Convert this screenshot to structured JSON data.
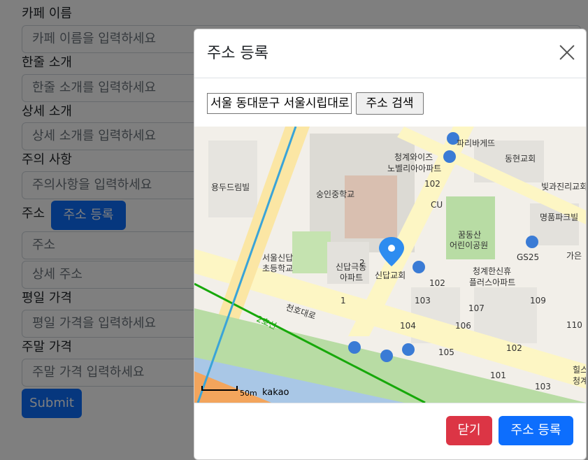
{
  "form": {
    "cafe_name_label": "카페 이름",
    "cafe_name_placeholder": "카페 이름을 입력하세요",
    "intro_label": "한줄 소개",
    "intro_placeholder": "한줄 소개를 입력하세요",
    "detail_label": "상세 소개",
    "detail_placeholder": "상세 소개를 입력하세요",
    "notice_label": "주의 사항",
    "notice_placeholder": "주의사항을 입력하세요",
    "address_label": "주소",
    "address_register_button": "주소 등록",
    "address_placeholder": "주소",
    "address_detail_placeholder": "상세 주소",
    "weekday_price_label": "평일 가격",
    "weekday_price_placeholder": "평일 가격을 입력하세요",
    "weekend_price_label": "주말 가격",
    "weekend_price_placeholder": "주말 가격 입력하세요",
    "submit_button": "Submit"
  },
  "modal": {
    "title": "주소 등록",
    "search_value": "서울 동대문구 서울시립대로",
    "search_button": "주소 검색",
    "close_button": "닫기",
    "register_button": "주소 등록"
  },
  "map": {
    "labels": {
      "pari": "파리바게뜨",
      "church1": "동현교회",
      "apt1_line1": "청계와이즈",
      "apt1_line2": "노벨리아아파트",
      "num102a": "102",
      "cu": "CU",
      "bitgwa": "빛과진리교회",
      "villa": "용두드림빌",
      "school1": "숭인중학교",
      "myeongpum": "명품파크빌",
      "park_line1": "꿈동산",
      "park_line2": "어린이공원",
      "gs25": "GS25",
      "gaeun": "가은",
      "school2_line1": "서울신답",
      "school2_line2": "초등학교",
      "apt2_line1": "신답극동",
      "apt2_line2": "아파트",
      "church2": "신답교회",
      "apt3_line1": "청계한신휴",
      "apt3_line2": "플러스아파트",
      "n2": "2",
      "n102b": "102",
      "n1": "1",
      "n103": "103",
      "n107": "107",
      "n109": "109",
      "road": "천호대로",
      "line2": "2호선",
      "n104": "104",
      "n106": "106",
      "n110": "110",
      "n102c": "102",
      "n105": "105",
      "n101": "101",
      "n103b": "103",
      "hil1": "힐스",
      "hil2": "청계",
      "scale": "50m",
      "brand": "kakao"
    },
    "colors": {
      "road": "#fdf6c4",
      "building": "#e3e1dc",
      "park": "#b8dca4",
      "water": "#a9c7e6",
      "subway": "#17a80a",
      "bus": "#3a7bd5",
      "marker": "#2d8cf0"
    }
  }
}
